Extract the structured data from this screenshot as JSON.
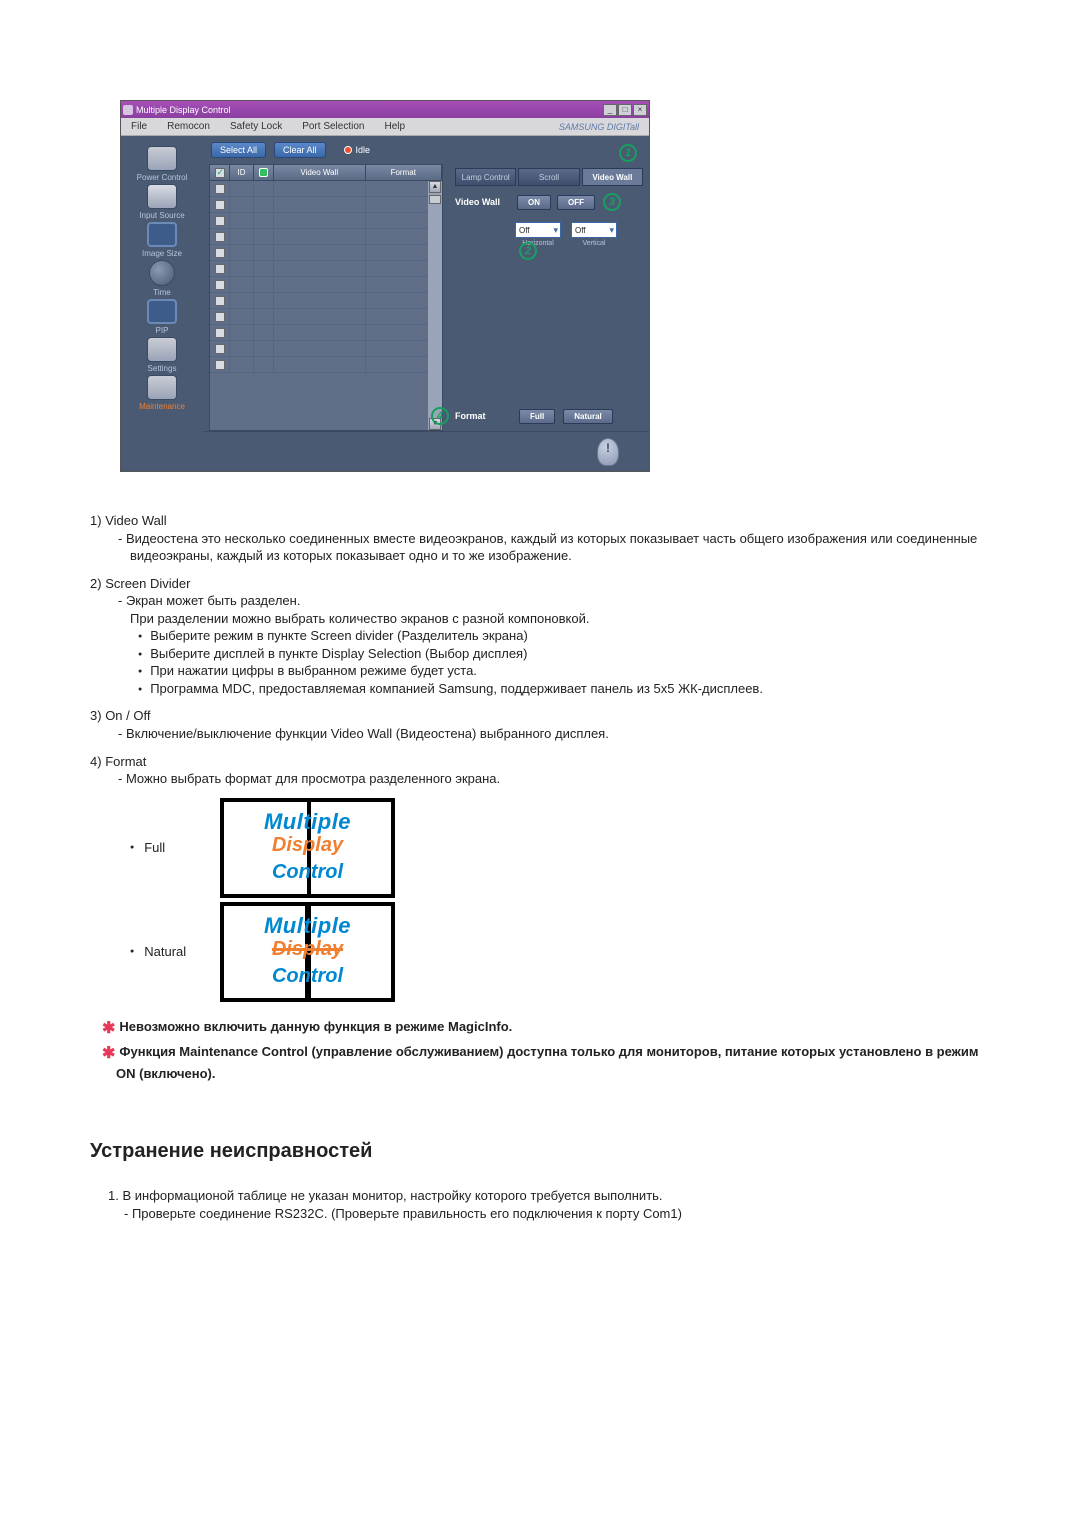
{
  "app": {
    "title": "Multiple Display Control",
    "menu": [
      "File",
      "Remocon",
      "Safety Lock",
      "Port Selection",
      "Help"
    ],
    "brand": "SAMSUNG DIGITall",
    "sidebar": [
      {
        "label": "Power Control"
      },
      {
        "label": "Input Source"
      },
      {
        "label": "Image Size"
      },
      {
        "label": "Time"
      },
      {
        "label": "PIP"
      },
      {
        "label": "Settings"
      },
      {
        "label": "Maintenance",
        "orange": true
      }
    ],
    "select_all": "Select All",
    "clear_all": "Clear All",
    "idle": "Idle",
    "table_headers": {
      "id": "ID",
      "video_wall": "Video Wall",
      "format": "Format"
    },
    "right": {
      "tabs": [
        "Lamp Control",
        "Scroll",
        "Video Wall"
      ],
      "active_tab": 2,
      "video_wall_label": "Video Wall",
      "on": "ON",
      "off": "OFF",
      "horizontal": {
        "value": "Off",
        "label": "Horizontal"
      },
      "vertical": {
        "value": "Off",
        "label": "Vertical"
      },
      "format_label": "Format",
      "full": "Full",
      "natural": "Natural"
    },
    "callouts": {
      "1": "1",
      "2": "2",
      "3": "3",
      "4": "4"
    }
  },
  "doc": {
    "items": [
      {
        "num": "1)",
        "title": "Video Wall",
        "subs": [
          "Видеостена это несколько соединенных вместе видеоэкранов, каждый из которых показывает часть общего изображения или соединенные видеоэкраны, каждый из которых показывает одно и то же изображение."
        ]
      },
      {
        "num": "2)",
        "title": "Screen Divider",
        "subs": [
          "Экран может быть разделен.",
          "При разделении можно выбрать количество экранов с разной компоновкой."
        ],
        "bullets": [
          "Выберите режим в пункте Screen divider (Разделитель экрана)",
          "Выберите дисплей в пункте Display Selection (Выбор дисплея)",
          "При нажатии цифры в выбранном режиме будет уста.",
          "Программа MDC, предоставляемая компанией Samsung, поддерживает панель из 5x5 ЖК-дисплеев."
        ]
      },
      {
        "num": "3)",
        "title": "On / Off",
        "subs": [
          "Включение/выключение функции Video Wall (Видеостена) выбранного дисплея."
        ]
      },
      {
        "num": "4)",
        "title": "Format",
        "subs": [
          "Можно выбрать формат для просмотра разделенного экрана."
        ]
      }
    ],
    "format_options": {
      "full": "Full",
      "natural": "Natural"
    },
    "mdc": {
      "l1": "Multiple",
      "l2": "Display",
      "l3": "Control"
    },
    "notes": [
      "Невозможно включить данную функция в режиме MagicInfo.",
      "Функция Maintenance Control (управление обслуживанием) доступна только для мониторов, питание которых установлено в режим ON (включено)."
    ],
    "troubleshoot_heading": "Устранение неисправностей",
    "troubleshoot": [
      {
        "num": "1.",
        "text": "В информационой таблице не указан монитор, настройку которого требуется выполнить.",
        "sub": "Проверьте соединение RS232C. (Проверьте правильность его подключения к порту Com1)"
      }
    ]
  }
}
